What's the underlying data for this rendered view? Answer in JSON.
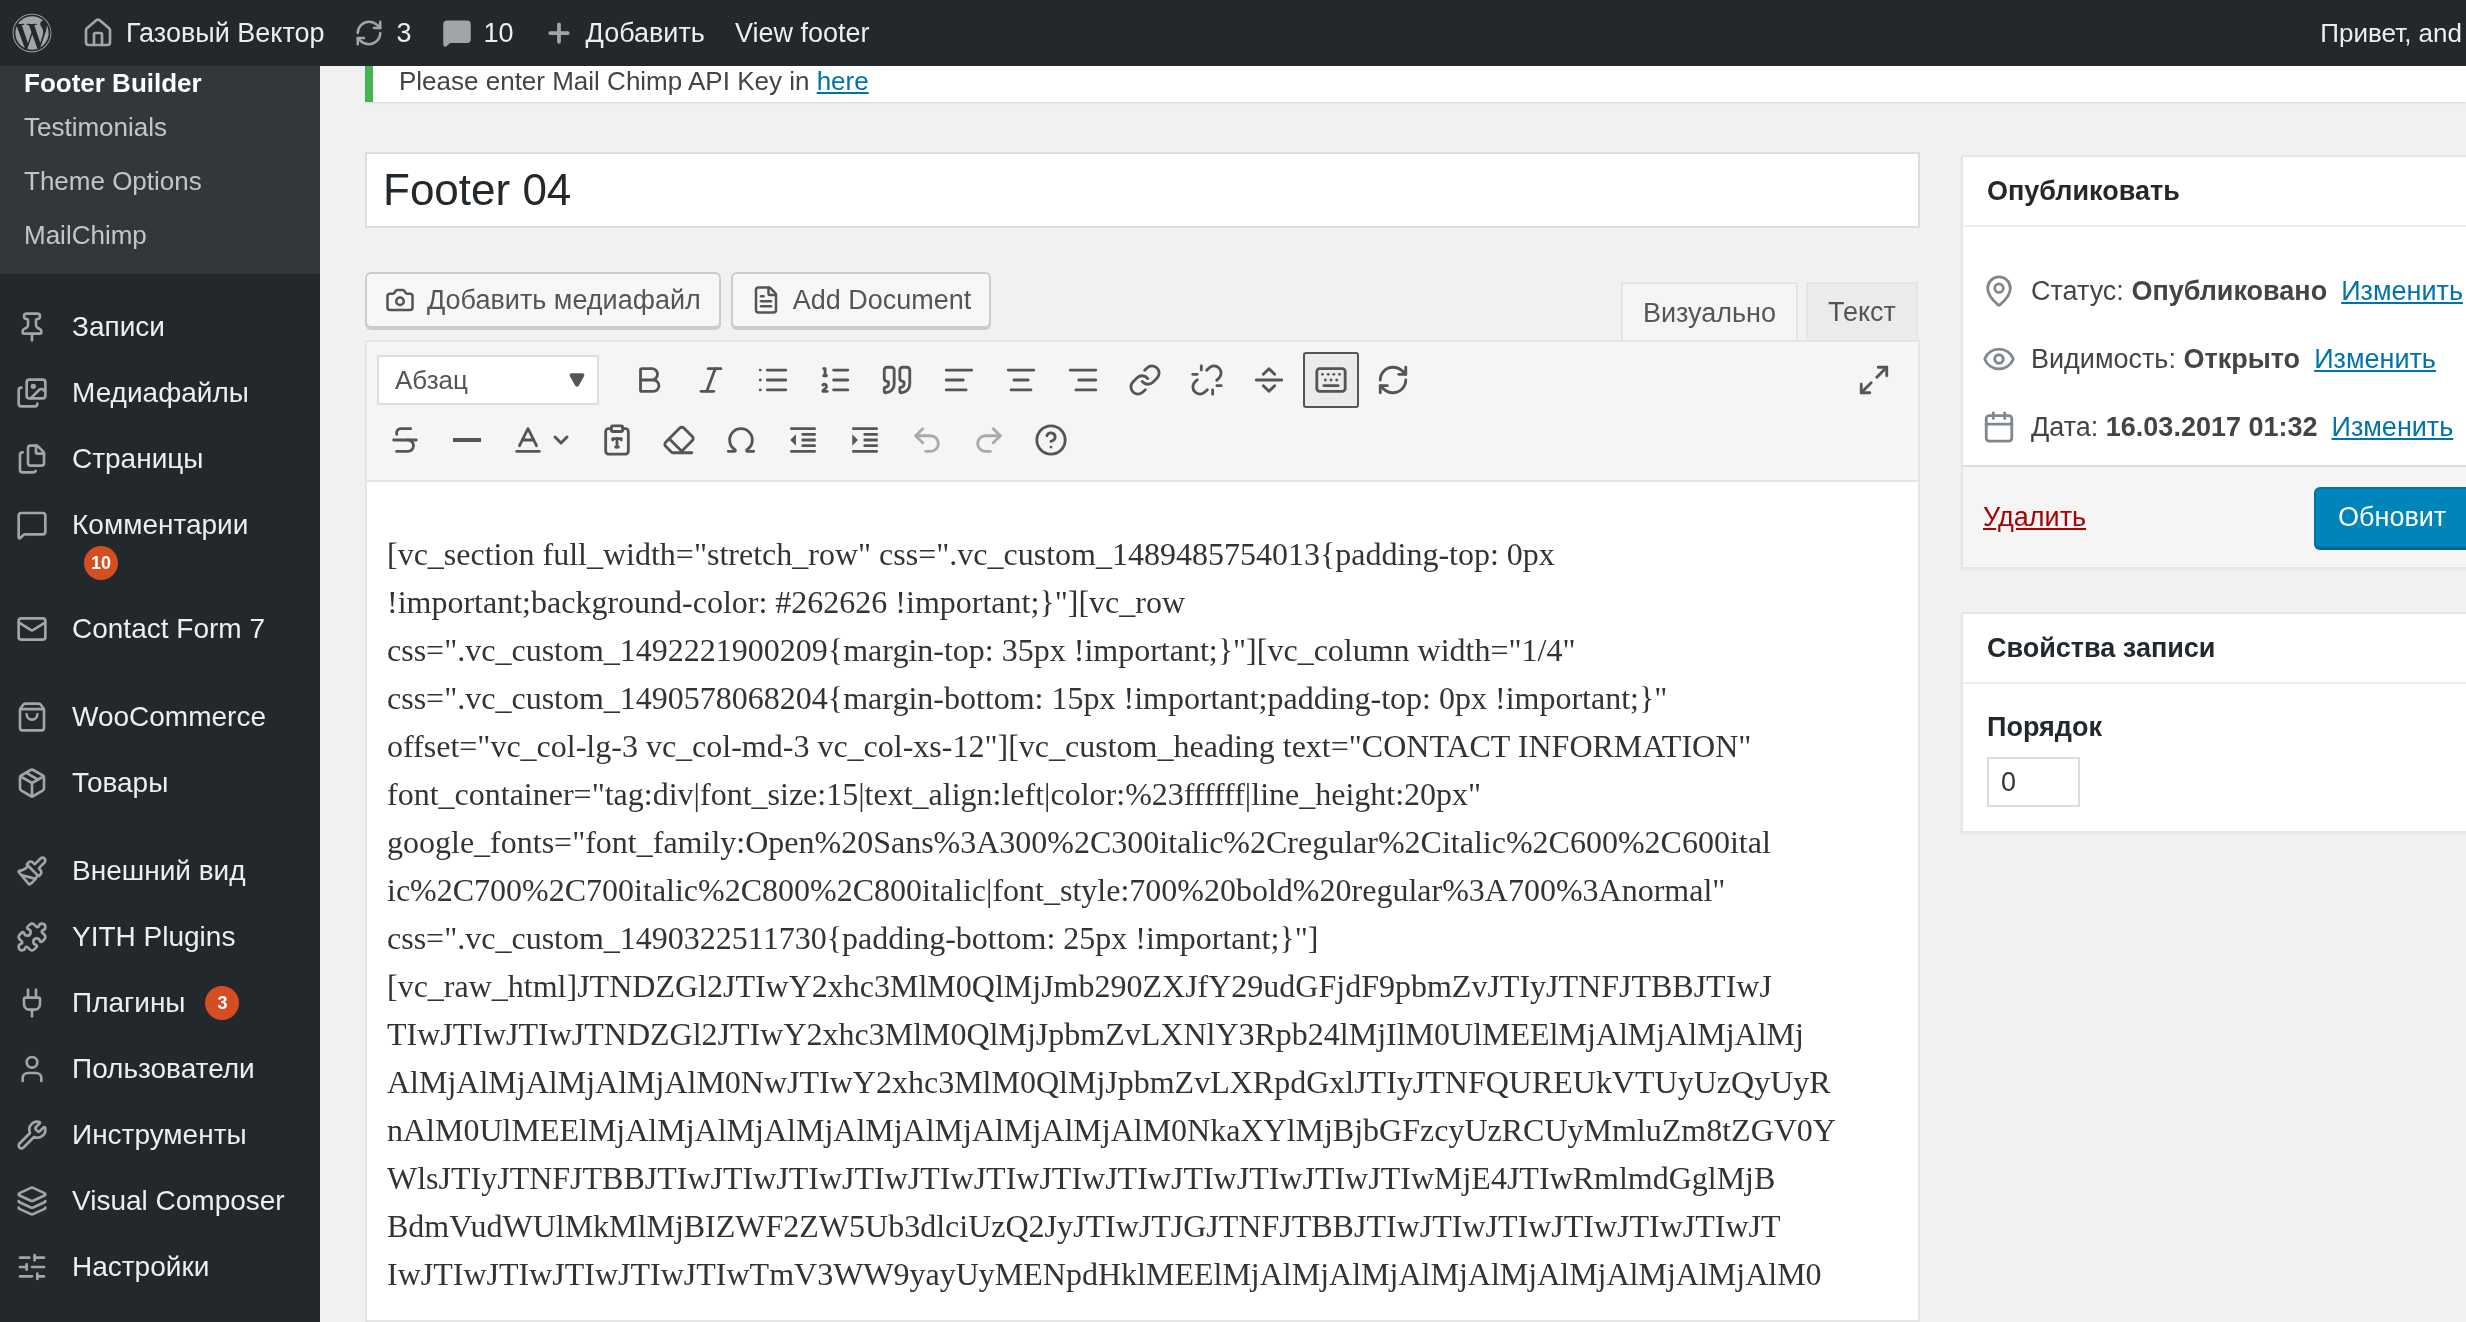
{
  "admin_bar": {
    "site": "Газовый Вектор",
    "updates": "3",
    "comments": "10",
    "new": "Добавить",
    "view": "View footer",
    "greeting": "Привет, and"
  },
  "sidebar": {
    "submenu": [
      {
        "label": "Footer Builder",
        "selected": true
      },
      {
        "label": "Testimonials",
        "selected": false
      },
      {
        "label": "Theme Options",
        "selected": false
      },
      {
        "label": "MailChimp",
        "selected": false
      }
    ],
    "menu_groups": [
      [
        {
          "label": "Записи"
        },
        {
          "label": "Медиафайлы"
        },
        {
          "label": "Страницы"
        },
        {
          "label": "Комментарии",
          "badge": "10",
          "badge_below": true
        },
        {
          "label": "Contact Form 7"
        }
      ],
      [
        {
          "label": "WooCommerce"
        },
        {
          "label": "Товары"
        }
      ],
      [
        {
          "label": "Внешний вид"
        },
        {
          "label": "YITH Plugins"
        },
        {
          "label": "Плагины",
          "badge": "3",
          "badge_below": false
        },
        {
          "label": "Пользователи"
        },
        {
          "label": "Инструменты"
        },
        {
          "label": "Visual Composer"
        },
        {
          "label": "Настройки"
        }
      ]
    ]
  },
  "notice": {
    "text": "Please enter Mail Chimp API Key in ",
    "link": "here"
  },
  "title": "Footer 04",
  "media_buttons": [
    "Добавить медиафайл",
    "Add Document"
  ],
  "editor_tabs": [
    {
      "label": "Визуально",
      "selected": true
    },
    {
      "label": "Текст",
      "selected": false
    }
  ],
  "toolbar": {
    "format": "Абзац",
    "rows": [
      [
        {
          "pressed": false,
          "disabled": false
        },
        {
          "pressed": false,
          "disabled": false
        },
        {
          "pressed": false,
          "disabled": false
        },
        {
          "pressed": false,
          "disabled": false
        },
        {
          "pressed": false,
          "disabled": false
        },
        {
          "pressed": false,
          "disabled": false
        },
        {
          "pressed": false,
          "disabled": false
        },
        {
          "pressed": false,
          "disabled": false
        },
        {
          "pressed": false,
          "disabled": false
        },
        {
          "pressed": false,
          "disabled": false
        },
        {
          "pressed": false,
          "disabled": false
        },
        {
          "pressed": true,
          "disabled": false
        },
        {
          "pressed": false,
          "disabled": false
        },
        {
          "pressed": false,
          "disabled": false
        }
      ],
      [
        {
          "pressed": false,
          "disabled": false
        },
        {
          "pressed": false,
          "disabled": false
        },
        {
          "pressed": false,
          "disabled": false
        },
        {
          "pressed": false,
          "disabled": false
        },
        {
          "pressed": false,
          "disabled": false
        },
        {
          "pressed": false,
          "disabled": false
        },
        {
          "pressed": false,
          "disabled": false
        },
        {
          "pressed": false,
          "disabled": false
        },
        {
          "pressed": false,
          "disabled": true
        },
        {
          "pressed": false,
          "disabled": true
        },
        {
          "pressed": false,
          "disabled": false
        }
      ]
    ]
  },
  "content_lines": [
    "[vc_section full_width=\"stretch_row\" css=\".vc_custom_1489485754013{padding-top: 0px",
    "!important;background-color: #262626 !important;}\"][vc_row",
    "css=\".vc_custom_1492221900209{margin-top: 35px !important;}\"][vc_column width=\"1/4\"",
    "css=\".vc_custom_1490578068204{margin-bottom: 15px !important;padding-top: 0px !important;}\"",
    "offset=\"vc_col-lg-3 vc_col-md-3 vc_col-xs-12\"][vc_custom_heading text=\"CONTACT INFORMATION\"",
    "font_container=\"tag:div|font_size:15|text_align:left|color:%23ffffff|line_height:20px\"",
    "google_fonts=\"font_family:Open%20Sans%3A300%2C300italic%2Cregular%2Citalic%2C600%2C600ital",
    "ic%2C700%2C700italic%2C800%2C800italic|font_style:700%20bold%20regular%3A700%3Anormal\"",
    "css=\".vc_custom_1490322511730{padding-bottom: 25px !important;}\"]",
    "[vc_raw_html]JTNDZGl2JTIwY2xhc3MlM0QlMjJmb290ZXJfY29udGFjdF9pbmZvJTIyJTNFJTBBJTIwJ",
    "TIwJTIwJTIwJTNDZGl2JTIwY2xhc3MlM0QlMjJpbmZvLXNlY3Rpb24lMjIlM0UlMEElMjAlMjAlMjAlMj",
    "AlMjAlMjAlMjAlMjAlM0NwJTIwY2xhc3MlM0QlMjJpbmZvLXRpdGxlJTIyJTNFQUREUkVTUyUzQyUyR",
    "nAlM0UlMEElMjAlMjAlMjAlMjAlMjAlMjAlMjAlMjAlM0NkaXYlMjBjbGFzcyUzRCUyMmluZm8tZGV0Y",
    "WlsJTIyJTNFJTBBJTIwJTIwJTIwJTIwJTIwJTIwJTIwJTIwJTIwJTIwJTIwJTIwMjE4JTIwRmlmdGglMjB",
    "BdmVudWUlMkMlMjBIZWF2ZW5Ub3dlciUzQ2JyJTIwJTJGJTNFJTBBJTIwJTIwJTIwJTIwJTIwJTIwJT",
    "IwJTIwJTIwJTIwJTIwJTIwTmV3WW9yayUyMENpdHklMEElMjAlMjAlMjAlMjAlMjAlMjAlMjAlMjAlM0"
  ],
  "publish": {
    "title": "Опубликовать",
    "rows": [
      {
        "label": "Статус:",
        "value": "Опубликовано",
        "link": "Изменить"
      },
      {
        "label": "Видимость:",
        "value": "Открыто",
        "link": "Изменить"
      },
      {
        "label": "Дата:",
        "value": "16.03.2017 01:32",
        "link": "Изменить"
      }
    ],
    "delete": "Удалить",
    "update": "Обновит"
  },
  "attributes": {
    "title": "Свойства записи",
    "order_label": "Порядок",
    "order_value": "0"
  }
}
